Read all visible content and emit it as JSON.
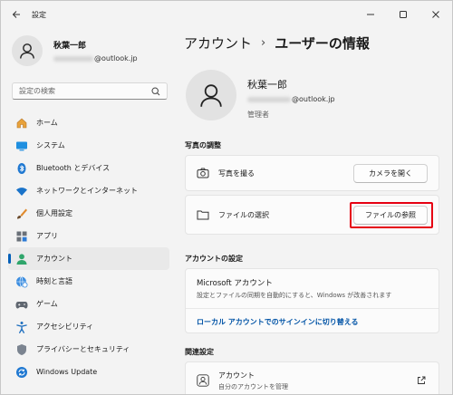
{
  "window": {
    "title": "設定"
  },
  "sidebar": {
    "profile": {
      "name": "秋葉一郎",
      "email_suffix": "@outlook.jp"
    },
    "search": {
      "placeholder": "設定の検索"
    },
    "items": [
      {
        "label": "ホーム",
        "icon": "home-icon"
      },
      {
        "label": "システム",
        "icon": "system-icon"
      },
      {
        "label": "Bluetooth とデバイス",
        "icon": "bluetooth-icon"
      },
      {
        "label": "ネットワークとインターネット",
        "icon": "wifi-icon"
      },
      {
        "label": "個人用設定",
        "icon": "brush-icon"
      },
      {
        "label": "アプリ",
        "icon": "apps-icon"
      },
      {
        "label": "アカウント",
        "icon": "account-icon",
        "active": true
      },
      {
        "label": "時刻と言語",
        "icon": "globe-clock-icon"
      },
      {
        "label": "ゲーム",
        "icon": "gamepad-icon"
      },
      {
        "label": "アクセシビリティ",
        "icon": "accessibility-icon"
      },
      {
        "label": "プライバシーとセキュリティ",
        "icon": "shield-icon"
      },
      {
        "label": "Windows Update",
        "icon": "update-icon"
      }
    ]
  },
  "main": {
    "breadcrumb": {
      "parent": "アカウント",
      "separator": "›",
      "current": "ユーザーの情報"
    },
    "user": {
      "name": "秋葉一郎",
      "email_suffix": "@outlook.jp",
      "role": "管理者"
    },
    "photo_section": {
      "title": "写真の調整",
      "camera_row": {
        "label": "写真を撮る",
        "button": "カメラを開く"
      },
      "file_row": {
        "label": "ファイルの選択",
        "button": "ファイルの参照"
      }
    },
    "account_settings": {
      "title": "アカウントの設定",
      "ms_title": "Microsoft アカウント",
      "ms_desc": "設定とファイルの同期を自動的にすると、Windows が改善されます",
      "ms_link": "ローカル アカウントでのサインインに切り替える"
    },
    "related": {
      "title": "関連設定",
      "item_title": "アカウント",
      "item_sub": "自分のアカウントを管理"
    }
  },
  "colors": {
    "accent": "#005fb8",
    "highlight": "#e60012",
    "link": "#0053a6"
  }
}
